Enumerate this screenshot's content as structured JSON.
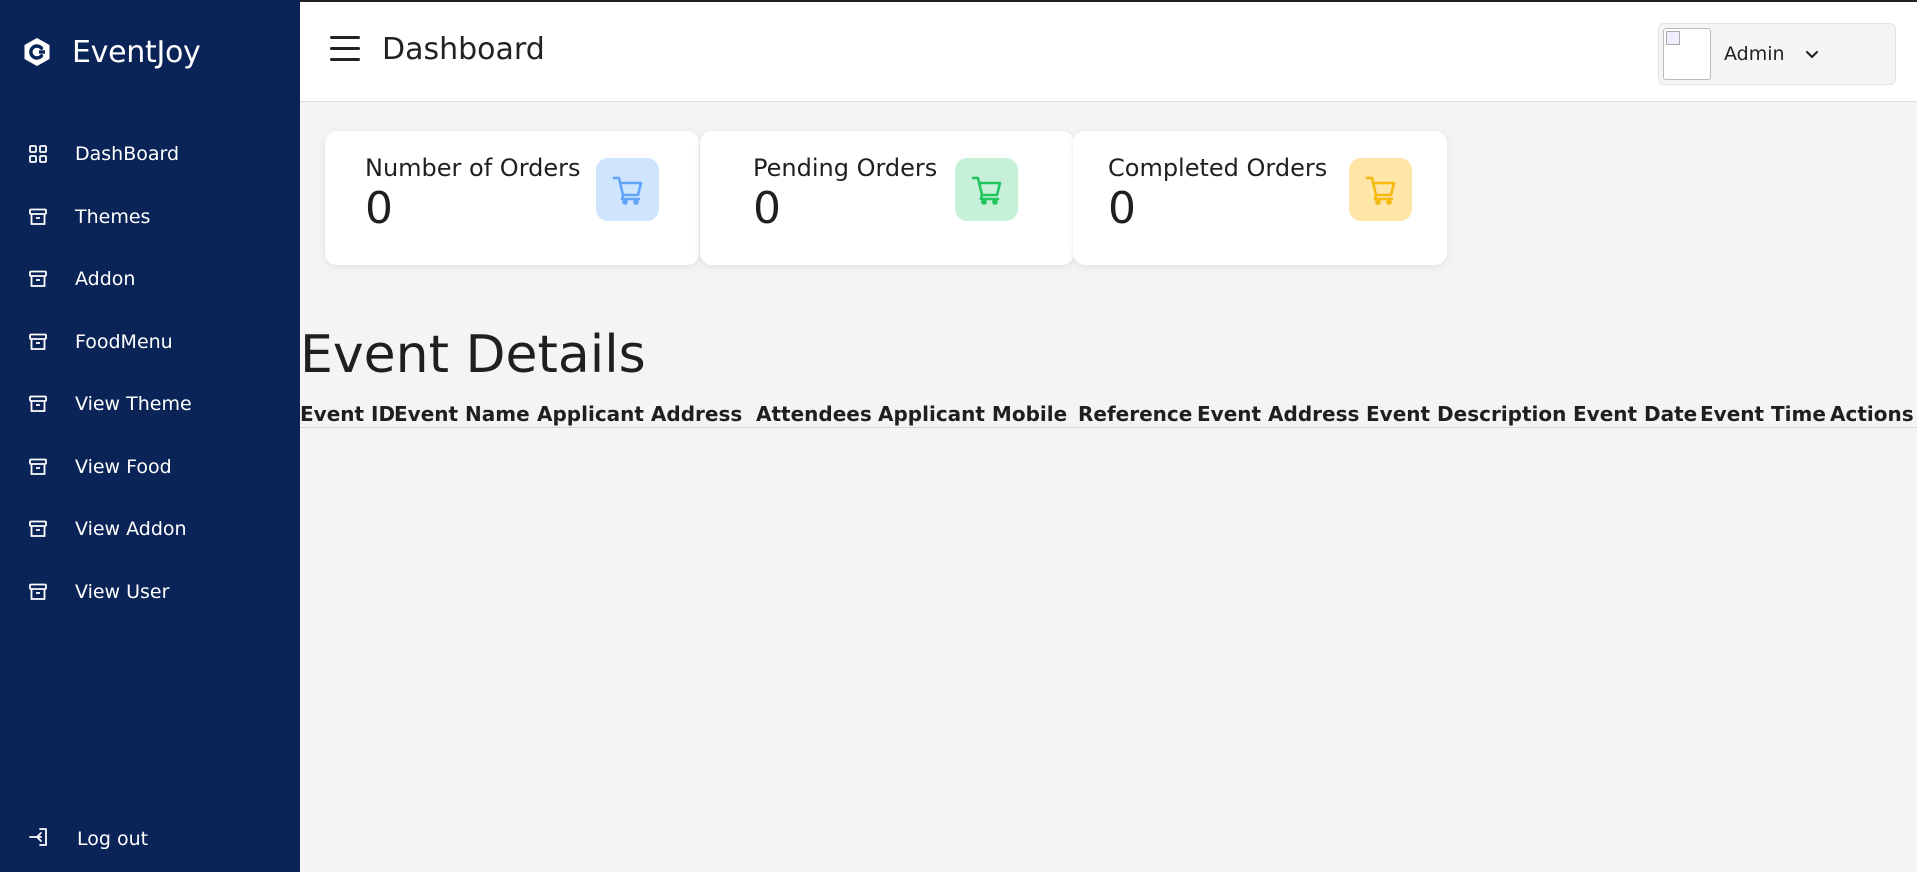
{
  "brand": {
    "name": "EventJoy",
    "logo_icon": "brand-c-icon"
  },
  "sidebar": {
    "items": [
      {
        "label": "DashBoard",
        "icon": "grid-icon"
      },
      {
        "label": "Themes",
        "icon": "archive-icon"
      },
      {
        "label": "Addon",
        "icon": "archive-icon"
      },
      {
        "label": "FoodMenu",
        "icon": "archive-icon"
      },
      {
        "label": "View Theme",
        "icon": "archive-icon"
      },
      {
        "label": "View Food",
        "icon": "archive-icon"
      },
      {
        "label": "View Addon",
        "icon": "archive-icon"
      },
      {
        "label": "View User",
        "icon": "archive-icon"
      }
    ],
    "logout": {
      "label": "Log out",
      "icon": "logout-icon"
    }
  },
  "header": {
    "title": "Dashboard",
    "user": {
      "name": "Admin"
    }
  },
  "cards": [
    {
      "title": "Number of Orders",
      "value": "0",
      "icon": "cart-icon",
      "color": "#60a5fa",
      "bg": "#cfe5fd"
    },
    {
      "title": "Pending Orders",
      "value": "0",
      "icon": "cart-icon",
      "color": "#22c55e",
      "bg": "#c6f1d8"
    },
    {
      "title": "Completed Orders",
      "value": "0",
      "icon": "cart-icon",
      "color": "#f5b90f",
      "bg": "#fde6a8"
    }
  ],
  "event_details": {
    "title": "Event Details",
    "columns": [
      "Event ID",
      "Event Name",
      "Applicant Address",
      "Attendees",
      "Applicant Mobile",
      "Reference",
      "Event Address",
      "Event Description",
      "Event Date",
      "Event Time",
      "Actions"
    ],
    "rows": []
  },
  "colors": {
    "sidebar_bg": "#0b2457",
    "page_bg": "#f4f4f4"
  }
}
